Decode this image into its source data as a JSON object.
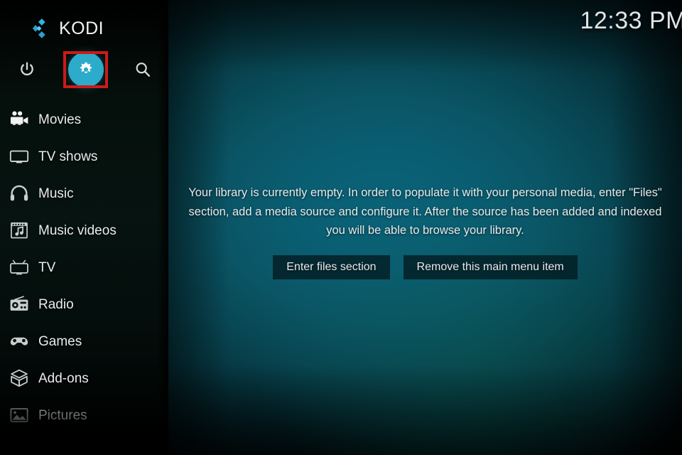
{
  "app": {
    "name": "KODI",
    "logo_icon": "kodi-logo-icon",
    "accent_color": "#2cabcb",
    "highlight_color": "#cc1a1a"
  },
  "header": {
    "clock": "12:33 PM"
  },
  "sidebar": {
    "top_actions": [
      {
        "name": "power",
        "label": "Power",
        "icon": "power-icon",
        "selected": false
      },
      {
        "name": "settings",
        "label": "Settings",
        "icon": "gear-icon",
        "selected": true
      },
      {
        "name": "search",
        "label": "Search",
        "icon": "search-icon",
        "selected": false
      }
    ],
    "items": [
      {
        "label": "Movies",
        "icon": "movie-camera-icon",
        "dimmed": false
      },
      {
        "label": "TV shows",
        "icon": "television-icon",
        "dimmed": false
      },
      {
        "label": "Music",
        "icon": "headphones-icon",
        "dimmed": false
      },
      {
        "label": "Music videos",
        "icon": "film-strip-note-icon",
        "dimmed": false
      },
      {
        "label": "TV",
        "icon": "retro-tv-icon",
        "dimmed": false
      },
      {
        "label": "Radio",
        "icon": "radio-icon",
        "dimmed": false
      },
      {
        "label": "Games",
        "icon": "gamepad-icon",
        "dimmed": false
      },
      {
        "label": "Add-ons",
        "icon": "addons-box-icon",
        "dimmed": false
      },
      {
        "label": "Pictures",
        "icon": "pictures-icon",
        "dimmed": true
      }
    ]
  },
  "main": {
    "empty_message": "Your library is currently empty. In order to populate it with your personal media, enter \"Files\" section, add a media source and configure it. After the source has been added and indexed you will be able to browse your library.",
    "buttons": [
      {
        "label": "Enter files section"
      },
      {
        "label": "Remove this main menu item"
      }
    ]
  }
}
